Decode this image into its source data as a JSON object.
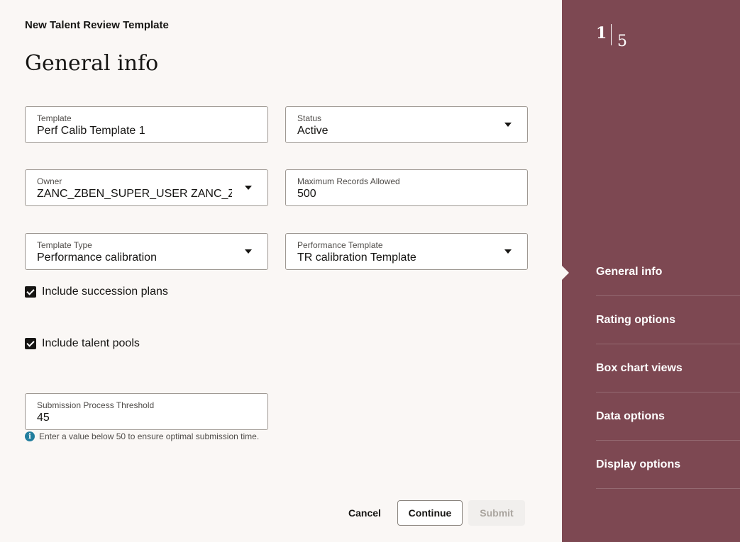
{
  "header": {
    "title": "New Talent Review Template",
    "section_title": "General info"
  },
  "form": {
    "template": {
      "label": "Template",
      "value": "Perf Calib Template 1"
    },
    "status": {
      "label": "Status",
      "value": "Active"
    },
    "owner": {
      "label": "Owner",
      "value": "ZANC_ZBEN_SUPER_USER ZANC_ZB"
    },
    "max_records": {
      "label": "Maximum Records Allowed",
      "value": "500"
    },
    "template_type": {
      "label": "Template Type",
      "value": "Performance calibration"
    },
    "performance_template": {
      "label": "Performance Template",
      "value": "TR calibration Template"
    },
    "include_succession": {
      "label": "Include succession plans",
      "checked": true
    },
    "include_pools": {
      "label": "Include talent pools",
      "checked": true
    },
    "threshold": {
      "label": "Submission Process Threshold",
      "value": "45",
      "hint": "Enter a value below 50 to ensure optimal submission time."
    }
  },
  "actions": {
    "cancel": "Cancel",
    "continue": "Continue",
    "submit": "Submit"
  },
  "stepper": {
    "current": "1",
    "total": "5",
    "steps": [
      {
        "label": "General info",
        "active": true
      },
      {
        "label": "Rating options",
        "active": false
      },
      {
        "label": "Box chart views",
        "active": false
      },
      {
        "label": "Data options",
        "active": false
      },
      {
        "label": "Display options",
        "active": false
      }
    ]
  },
  "colors": {
    "sidebar": "#7d4852",
    "info": "#227e9e"
  },
  "icons": {
    "info": "info-icon",
    "dropdown": "chevron-down-icon",
    "check": "checkmark-icon"
  }
}
